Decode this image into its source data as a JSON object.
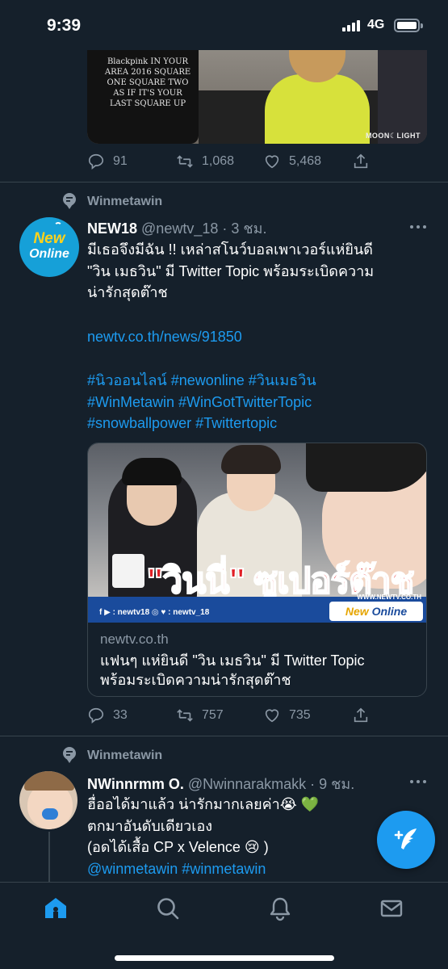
{
  "status": {
    "time": "9:39",
    "network": "4G"
  },
  "tweet1": {
    "media": {
      "shirt_text": "Blackpink IN YOUR AREA 2016 SQUARE ONE SQUARE TWO AS IF IT'S YOUR LAST SQUARE UP",
      "watermark": "MOON☾LIGHT"
    },
    "actions": {
      "replies": "91",
      "retweets": "1,068",
      "likes": "5,468"
    }
  },
  "tweet2": {
    "context": "Winmetawin",
    "avatar": {
      "line1": "New",
      "line2": "Online"
    },
    "name": "NEW18",
    "handle_time": "@newtv_18 · 3 ชม.",
    "text_lines": [
      "มีเธอจึงมีฉัน !! เหล่าสโนว์บอลเพาเวอร์แห่ยินดี",
      "\"วิน เมธวิน\" มี Twitter Topic พร้อมระเบิดความ",
      "น่ารักสุดต๊าช"
    ],
    "link": "newtv.co.th/news/91850",
    "hashtags": [
      "#นิวออนไลน์ #newonline #วินเมธวิน",
      "#WinMetawin #WinGotTwitterTopic",
      "#snowballpower #Twittertopic"
    ],
    "card": {
      "image_title": "\"วินนี่\" ซูเปอร์ต๊าช",
      "image_social": "f ▶ : newtv18    ◎ ♥ : newtv_18",
      "image_url": "WWW.NEWTV.CO.TH",
      "image_brand_1": "New",
      "image_brand_2": "Online",
      "domain": "newtv.co.th",
      "title_lines": [
        "แฟนๆ แห่ยินดี \"วิน เมธวิน\" มี Twitter Topic",
        "พร้อมระเบิดความน่ารักสุดต๊าช"
      ]
    },
    "actions": {
      "replies": "33",
      "retweets": "757",
      "likes": "735"
    }
  },
  "tweet3": {
    "context": "Winmetawin",
    "name": "NWinnrmm O.",
    "handle_time": "@Nwinnarakmakk · 9 ชม.",
    "text_lines": [
      "ฮื่ออได้มาแล้ว น่ารักมากเลยค่า😭 💚",
      "ตกมาอันดับเดียวเอง",
      "(อดได้เสื้อ CP x Velence 😢 )"
    ],
    "mentions": "@winmetawin #winmetawin"
  },
  "colors": {
    "background": "#15202b",
    "accent": "#1d9bf0",
    "muted": "#8b98a5",
    "divider": "#38444d"
  }
}
